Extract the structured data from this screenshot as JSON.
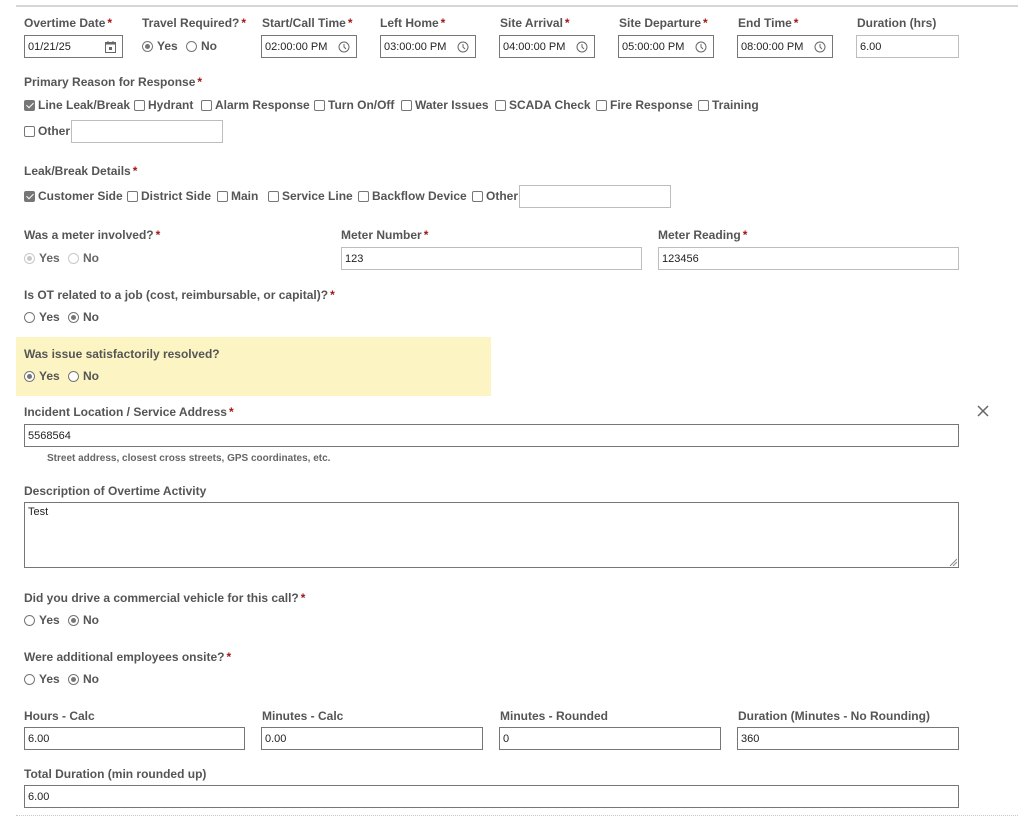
{
  "row1": {
    "overtime_date": {
      "label": "Overtime Date",
      "value": "01/21/25",
      "required": "*",
      "icon": "calendar-icon"
    },
    "travel_required": {
      "label": "Travel Required?",
      "required": "*",
      "options": [
        {
          "label": "Yes",
          "checked": true
        },
        {
          "label": "No",
          "checked": false
        }
      ]
    },
    "start_call_time": {
      "label": "Start/Call Time",
      "value": "02:00:00 PM",
      "required": "*",
      "icon": "clock-icon"
    },
    "left_home": {
      "label": "Left Home",
      "value": "03:00:00 PM",
      "required": "*",
      "icon": "clock-icon"
    },
    "site_arrival": {
      "label": "Site Arrival",
      "value": "04:00:00 PM",
      "required": "*",
      "icon": "clock-icon"
    },
    "site_departure": {
      "label": "Site Departure",
      "value": "05:00:00 PM",
      "required": "*",
      "icon": "clock-icon"
    },
    "end_time": {
      "label": "End Time",
      "value": "08:00:00 PM",
      "required": "*",
      "icon": "clock-icon"
    },
    "duration_hrs": {
      "label": "Duration (hrs)",
      "value": "6.00"
    }
  },
  "primary_reason": {
    "label": "Primary Reason for Response",
    "required": "*",
    "options": [
      {
        "label": "Line Leak/Break",
        "checked": true
      },
      {
        "label": "Hydrant",
        "checked": false
      },
      {
        "label": "Alarm Response",
        "checked": false
      },
      {
        "label": "Turn On/Off",
        "checked": false
      },
      {
        "label": "Water Issues",
        "checked": false
      },
      {
        "label": "SCADA Check",
        "checked": false
      },
      {
        "label": "Fire Response",
        "checked": false
      },
      {
        "label": "Training",
        "checked": false
      },
      {
        "label": "Other",
        "checked": false
      }
    ],
    "other_value": ""
  },
  "leak_break": {
    "label": "Leak/Break Details",
    "required": "*",
    "options": [
      {
        "label": "Customer Side",
        "checked": true
      },
      {
        "label": "District Side",
        "checked": false
      },
      {
        "label": "Main",
        "checked": false
      },
      {
        "label": "Service Line",
        "checked": false
      },
      {
        "label": "Backflow Device",
        "checked": false
      },
      {
        "label": "Other",
        "checked": false
      }
    ],
    "other_value": ""
  },
  "meter": {
    "involved_label": "Was a meter involved?",
    "required": "*",
    "options": [
      {
        "label": "Yes",
        "checked": true
      },
      {
        "label": "No",
        "checked": false
      }
    ],
    "number_label": "Meter Number",
    "number_value": "123",
    "reading_label": "Meter Reading",
    "reading_value": "123456"
  },
  "ot_job": {
    "label": "Is OT related to a job (cost, reimbursable, or capital)?",
    "required": "*",
    "options": [
      {
        "label": "Yes",
        "checked": false
      },
      {
        "label": "No",
        "checked": true
      }
    ]
  },
  "resolved": {
    "label": "Was issue satisfactorily resolved?",
    "options": [
      {
        "label": "Yes",
        "checked": true
      },
      {
        "label": "No",
        "checked": false
      }
    ]
  },
  "incident": {
    "label": "Incident Location / Service Address",
    "required": "*",
    "value": "5568564",
    "hint": "Street address, closest cross streets, GPS coordinates, etc.",
    "close_icon": "close-icon"
  },
  "description": {
    "label": "Description of Overtime Activity",
    "value": "Test"
  },
  "commercial_vehicle": {
    "label": "Did you drive a commercial vehicle for this call?",
    "required": "*",
    "options": [
      {
        "label": "Yes",
        "checked": false
      },
      {
        "label": "No",
        "checked": true
      }
    ]
  },
  "additional_employees": {
    "label": "Were additional employees onsite?",
    "required": "*",
    "options": [
      {
        "label": "Yes",
        "checked": false
      },
      {
        "label": "No",
        "checked": true
      }
    ]
  },
  "calc": {
    "hours_label": "Hours - Calc",
    "hours_value": "6.00",
    "minutes_label": "Minutes - Calc",
    "minutes_value": "0.00",
    "minutes_rounded_label": "Minutes - Rounded",
    "minutes_rounded_value": "0",
    "duration_minutes_label": "Duration (Minutes - No Rounding)",
    "duration_minutes_value": "360",
    "total_label": "Total Duration (min rounded up)",
    "total_value": "6.00"
  }
}
